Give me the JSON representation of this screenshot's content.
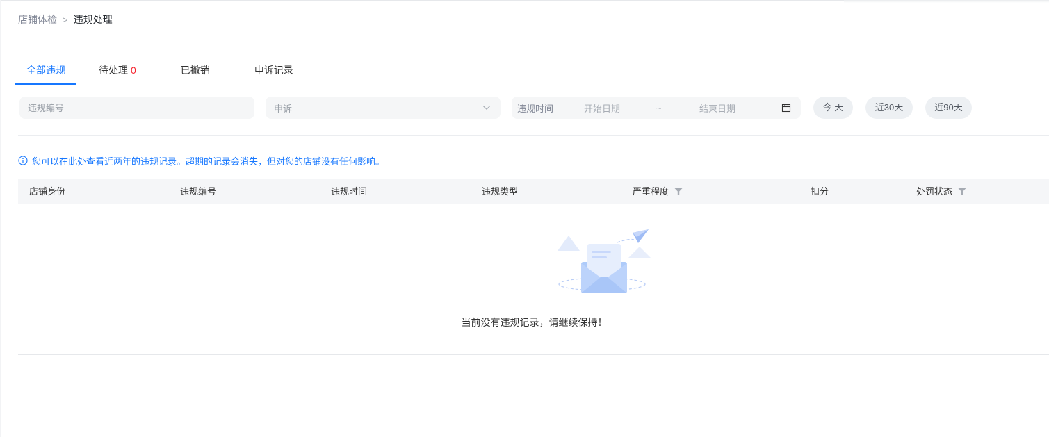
{
  "breadcrumb": {
    "root": "店铺体检",
    "separator": ">",
    "current": "违规处理"
  },
  "tabs": [
    {
      "label": "全部违规",
      "active": true
    },
    {
      "label": "待处理",
      "count": "0"
    },
    {
      "label": "已撤销"
    },
    {
      "label": "申诉记录"
    }
  ],
  "filters": {
    "code_placeholder": "违规编号",
    "appeal_select": {
      "value": "申诉"
    },
    "date_range": {
      "label": "违规时间",
      "start_placeholder": "开始日期",
      "separator": "~",
      "end_placeholder": "结束日期"
    },
    "quick_buttons": [
      "今 天",
      "近30天",
      "近90天"
    ]
  },
  "notice": "您可以在此处查看近两年的违规记录。超期的记录会消失，但对您的店铺没有任何影响。",
  "table": {
    "columns": [
      "店铺身份",
      "违规编号",
      "违规时间",
      "违规类型",
      "严重程度",
      "扣分",
      "处罚状态"
    ]
  },
  "empty_state": {
    "text": "当前没有违规记录，请继续保持！"
  },
  "colors": {
    "accent": "#1677ff",
    "danger": "#f5222d"
  }
}
